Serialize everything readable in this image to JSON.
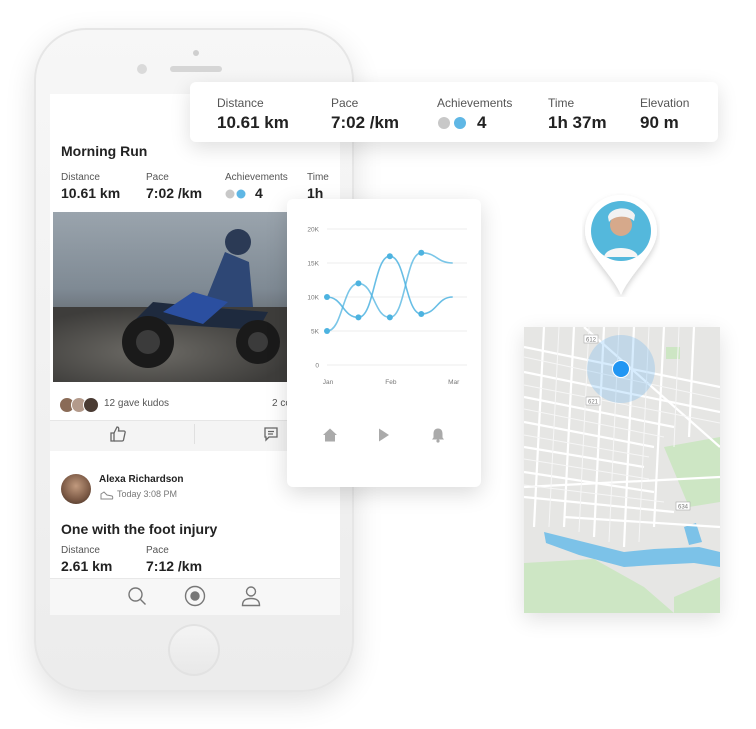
{
  "stats_card": {
    "items": [
      {
        "label": "Distance",
        "value": "10.61 km"
      },
      {
        "label": "Pace",
        "value": "7:02 /km"
      },
      {
        "label": "Achievements",
        "value": "4"
      },
      {
        "label": "Time",
        "value": "1h 37m"
      },
      {
        "label": "Elevation",
        "value": "90 m"
      }
    ]
  },
  "phone": {
    "activity": {
      "title": "Morning Run",
      "stats": [
        {
          "label": "Distance",
          "value": "10.61 km"
        },
        {
          "label": "Pace",
          "value": "7:02 /km"
        },
        {
          "label": "Achievements",
          "value": "4"
        },
        {
          "label": "Time",
          "value": "1h"
        }
      ],
      "kudos": "12 gave kudos",
      "comments": "2 co"
    },
    "post": {
      "author": "Alexa Richardson",
      "time": "Today 3:08 PM",
      "title": "One with the foot injury",
      "stats": [
        {
          "label": "Distance",
          "value": "2.61 km"
        },
        {
          "label": "Pace",
          "value": "7:12 /km"
        }
      ]
    },
    "tabbar": [
      "search-icon",
      "record-icon",
      "profile-icon"
    ]
  },
  "chart_data": {
    "type": "line",
    "categories": [
      "Jan",
      "Feb",
      "Mar"
    ],
    "y_ticks": [
      "20K",
      "15K",
      "10K",
      "5K",
      "0"
    ],
    "ylim": [
      0,
      20000
    ],
    "x": [
      0,
      0.5,
      1,
      1.5,
      2,
      2.5,
      3,
      3.5,
      4,
      4.2
    ],
    "series": [
      {
        "values": [
          10000,
          null,
          7000,
          null,
          16000,
          null,
          7500,
          null,
          10000,
          null
        ],
        "color": "#4db3e0"
      },
      {
        "values": [
          5000,
          null,
          12000,
          null,
          7000,
          null,
          16500,
          null,
          15000,
          null
        ],
        "color": "#4db3e0"
      }
    ],
    "nav_icons": [
      "home-icon",
      "play-icon",
      "bell-icon"
    ]
  },
  "map": {
    "road_labels": [
      "612",
      "621",
      "634"
    ],
    "accent": "#2196f3"
  }
}
